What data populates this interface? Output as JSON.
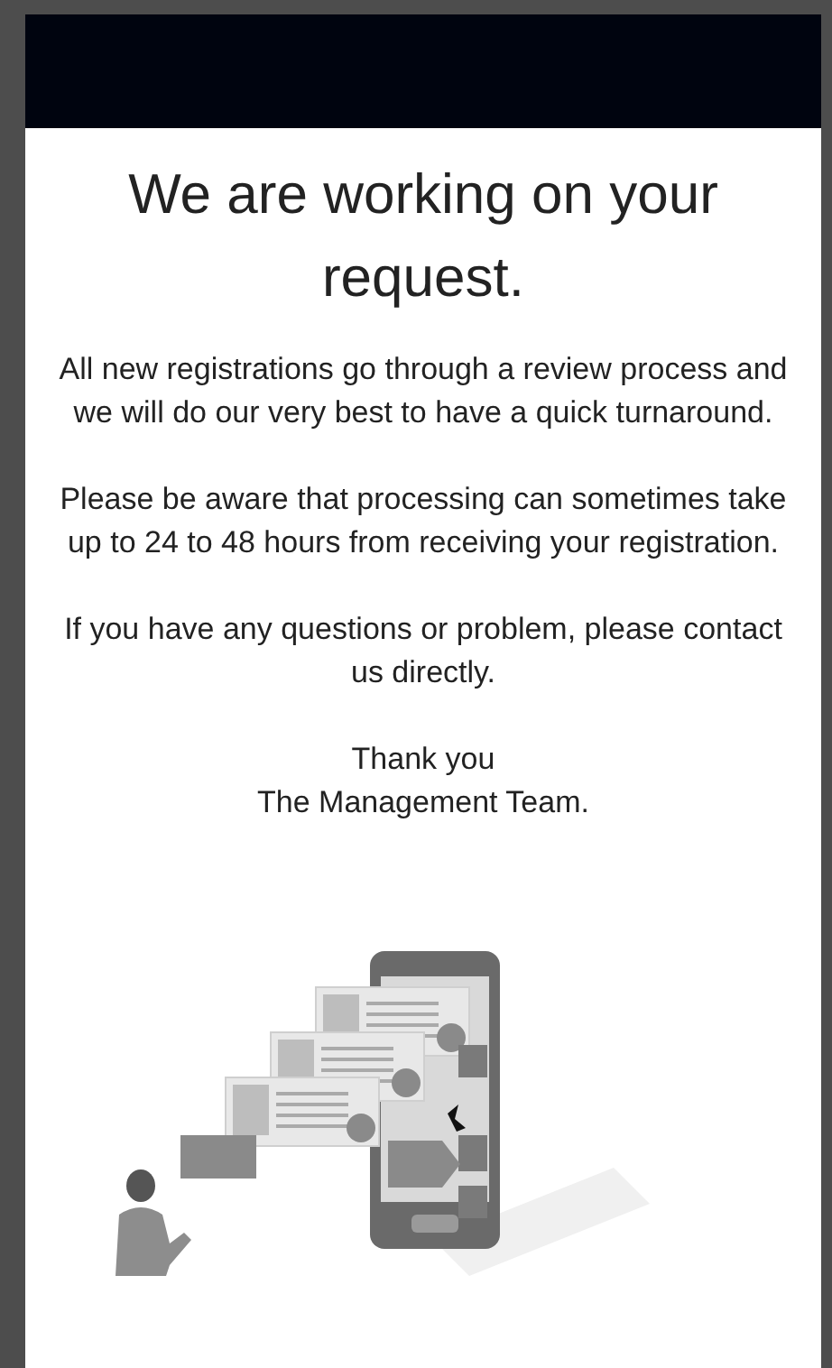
{
  "title": "We are working on your request.",
  "paragraphs": [
    "All new registrations go through a review process and we will do our very best to have a quick turnaround.",
    "Please be aware that processing can sometimes take up to 24 to 48 hours from receiving your registration.",
    "If you have any questions or problem, please contact us directly."
  ],
  "signoff": [
    "Thank you",
    "The Management Team."
  ]
}
